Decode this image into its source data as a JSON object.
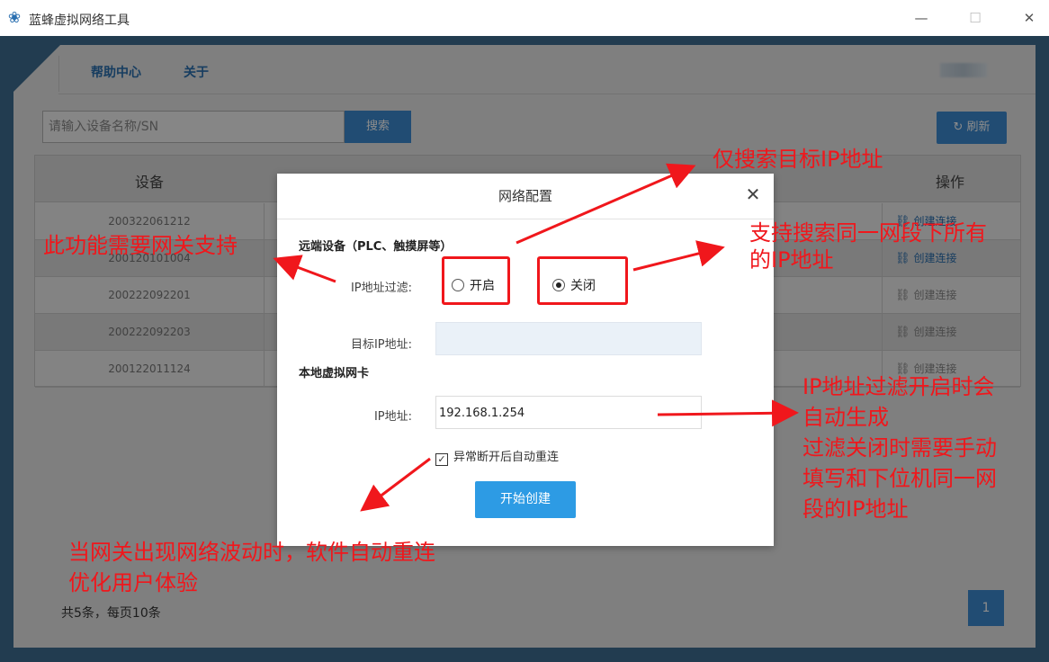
{
  "window": {
    "title": "蓝蜂虚拟网络工具",
    "controls": {
      "minimize": "—",
      "maximize": "☐",
      "close": "✕"
    }
  },
  "nav": {
    "items": [
      "帮助中心",
      "关于"
    ]
  },
  "search": {
    "placeholder": "请输入设备名称/SN",
    "button": "搜索"
  },
  "refresh": {
    "icon": "↻",
    "label": "刷新"
  },
  "table": {
    "headers": {
      "device": "设备",
      "operation": "操作"
    },
    "rows": [
      {
        "sn": "200322061212",
        "op": "创建连接",
        "active": true
      },
      {
        "sn": "200120101004",
        "op": "创建连接",
        "active": true
      },
      {
        "sn": "200222092201",
        "op": "创建连接",
        "active": false
      },
      {
        "sn": "200222092203",
        "op": "创建连接",
        "active": false
      },
      {
        "sn": "200122011124",
        "op": "创建连接",
        "active": false
      }
    ]
  },
  "pagination": {
    "total_text": "共5条，每页10条",
    "current_page": "1"
  },
  "dialog": {
    "title": "网络配置",
    "close": "✕",
    "remote_section": "远端设备（PLC、触摸屏等）",
    "ip_filter_label": "IP地址过滤:",
    "filter_on": "开启",
    "filter_off": "关闭",
    "filter_selected": "关闭",
    "target_ip_label": "目标IP地址:",
    "target_ip_value": "",
    "local_section": "本地虚拟网卡",
    "ip_label": "IP地址:",
    "ip_value": "192.168.1.254",
    "auto_reconnect_label": "异常断开后自动重连",
    "auto_reconnect_checked": true,
    "start_button": "开始创建"
  },
  "annotations": {
    "search_target": "仅搜索目标IP地址",
    "gateway_support": "此功能需要网关支持",
    "search_all_line1": "支持搜索同一网段下所有",
    "search_all_line2": "的IP地址",
    "ip_note_line1": "IP地址过滤开启时会",
    "ip_note_line2": "自动生成",
    "ip_note_line3": "过滤关闭时需要手动",
    "ip_note_line4": "填写和下位机同一网",
    "ip_note_line5": "段的IP地址",
    "reconnect_line1": "当网关出现网络波动时，软件自动重连",
    "reconnect_line2": "优化用户体验",
    "color": "#f0171c"
  },
  "colors": {
    "accent": "#3d8ad1",
    "frame": "#3e6e92",
    "primary_button": "#2d9be4"
  }
}
